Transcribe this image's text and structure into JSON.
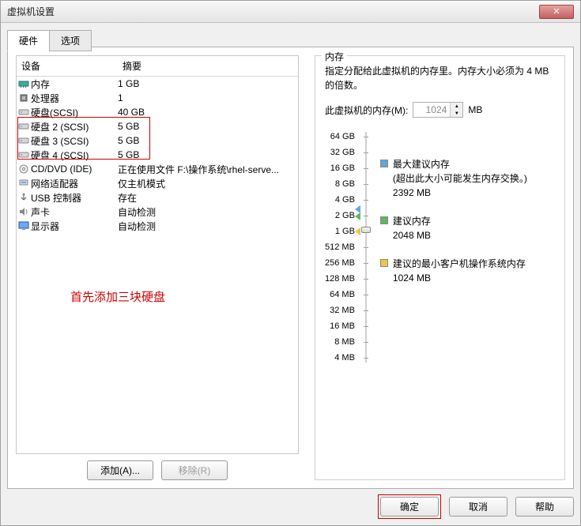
{
  "window": {
    "title": "虚拟机设置"
  },
  "tabs": {
    "hardware": "硬件",
    "options": "选项"
  },
  "columns": {
    "device": "设备",
    "summary": "摘要"
  },
  "devices": [
    {
      "icon": "memory",
      "name": "内存",
      "summary": "1 GB"
    },
    {
      "icon": "cpu",
      "name": "处理器",
      "summary": "1"
    },
    {
      "icon": "disk",
      "name": "硬盘(SCSI)",
      "summary": "40 GB"
    },
    {
      "icon": "disk",
      "name": "硬盘 2 (SCSI)",
      "summary": "5 GB"
    },
    {
      "icon": "disk",
      "name": "硬盘 3 (SCSI)",
      "summary": "5 GB"
    },
    {
      "icon": "disk",
      "name": "硬盘 4 (SCSI)",
      "summary": "5 GB"
    },
    {
      "icon": "cd",
      "name": "CD/DVD (IDE)",
      "summary": "正在使用文件 F:\\操作系统\\rhel-serve..."
    },
    {
      "icon": "net",
      "name": "网络适配器",
      "summary": "仅主机模式"
    },
    {
      "icon": "usb",
      "name": "USB 控制器",
      "summary": "存在"
    },
    {
      "icon": "sound",
      "name": "声卡",
      "summary": "自动检测"
    },
    {
      "icon": "display",
      "name": "显示器",
      "summary": "自动检测"
    }
  ],
  "annotation": "首先添加三块硬盘",
  "buttons": {
    "add": "添加(A)...",
    "remove": "移除(R)",
    "ok": "确定",
    "cancel": "取消",
    "help": "帮助"
  },
  "memory": {
    "legend": "内存",
    "desc": "指定分配给此虚拟机的内存里。内存大小必须为 4 MB 的倍数。",
    "label": "此虚拟机的内存(M):",
    "value": "1024",
    "unit": "MB",
    "scale": [
      "64 GB",
      "32 GB",
      "16 GB",
      "8 GB",
      "4 GB",
      "2 GB",
      "1 GB",
      "512 MB",
      "256 MB",
      "128 MB",
      "64 MB",
      "32 MB",
      "16 MB",
      "8 MB",
      "4 MB"
    ],
    "recs": {
      "max": {
        "label": "最大建议内存",
        "note": "(超出此大小可能发生内存交换。)",
        "value": "2392 MB",
        "color": "#5fa8d8"
      },
      "rec": {
        "label": "建议内存",
        "value": "2048 MB",
        "color": "#5fb85f"
      },
      "min": {
        "label": "建议的最小客户机操作系统内存",
        "value": "1024 MB",
        "color": "#e8c84a"
      }
    }
  }
}
